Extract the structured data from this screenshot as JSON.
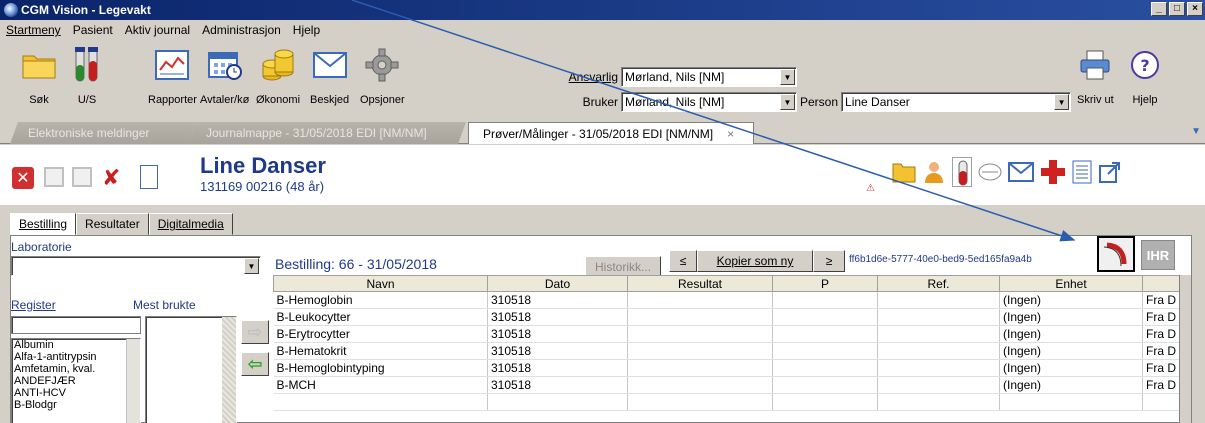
{
  "window": {
    "title": "CGM Vision - Legevakt",
    "controls": [
      "_",
      "□",
      "×"
    ]
  },
  "menu": [
    "Startmeny",
    "Pasient",
    "Aktiv journal",
    "Administrasjon",
    "Hjelp"
  ],
  "toolbar": {
    "buttons": [
      "Søk",
      "U/S",
      "Rapporter",
      "Avtaler/kø",
      "Økonomi",
      "Beskjed",
      "Opsjoner"
    ],
    "ansvarlig_label": "Ansvarlig",
    "ansvarlig_value": "Mørland, Nils [NM]",
    "bruker_label": "Bruker",
    "bruker_value": "Mørland, Nils [NM]",
    "person_label": "Person",
    "person_value": "Line Danser",
    "print_label": "Skriv ut",
    "help_label": "Hjelp"
  },
  "doc_tabs": [
    {
      "label": "Elektroniske meldinger",
      "active": false
    },
    {
      "label": "Journalmappe - 31/05/2018 EDI [NM/NM]",
      "active": false
    },
    {
      "label": "Prøver/Målinger - 31/05/2018 EDI [NM/NM]",
      "active": true
    }
  ],
  "patient": {
    "name": "Line Danser",
    "id_line": "131169 00216 (48 år)"
  },
  "sub_tabs": [
    "Bestilling",
    "Resultater",
    "Digitalmedia"
  ],
  "left": {
    "laboratorie_label": "Laboratorie",
    "laboratorie_value": "",
    "register_label": "Register",
    "mest_brukte_label": "Mest brukte",
    "register_items": [
      "Albumin",
      "Alfa-1-antitrypsin",
      "Amfetamin, kval.",
      "ANDEFJÆR",
      "ANTI-HCV",
      "B-Blodgr"
    ]
  },
  "order": {
    "title": "Bestilling: 66 - 31/05/2018",
    "historikk_label": "Historikk...",
    "prev_label": "≤",
    "copy_label": "Kopier som ny",
    "next_label": "≥",
    "guid": "ff6b1d6e-5777-40e0-bed9-5ed165fa9a4b",
    "ihr_label": "IHR"
  },
  "table": {
    "columns": [
      "Navn",
      "Dato",
      "Resultat",
      "P",
      "Ref.",
      "Enhet",
      ""
    ],
    "rows": [
      [
        "B-Hemoglobin",
        "310518",
        "",
        "",
        "",
        "(Ingen)",
        "Fra D"
      ],
      [
        "B-Leukocytter",
        "310518",
        "",
        "",
        "",
        "(Ingen)",
        "Fra D"
      ],
      [
        "B-Erytrocytter",
        "310518",
        "",
        "",
        "",
        "(Ingen)",
        "Fra D"
      ],
      [
        "B-Hematokrit",
        "310518",
        "",
        "",
        "",
        "(Ingen)",
        "Fra D"
      ],
      [
        "B-Hemoglobintyping",
        "310518",
        "",
        "",
        "",
        "(Ingen)",
        "Fra D"
      ],
      [
        "B-MCH",
        "310518",
        "",
        "",
        "",
        "(Ingen)",
        "Fra D"
      ]
    ]
  },
  "colors": {
    "accent": "#1f3a8a",
    "titlebar": "#0a246a",
    "arrow": "#2a5db0"
  }
}
